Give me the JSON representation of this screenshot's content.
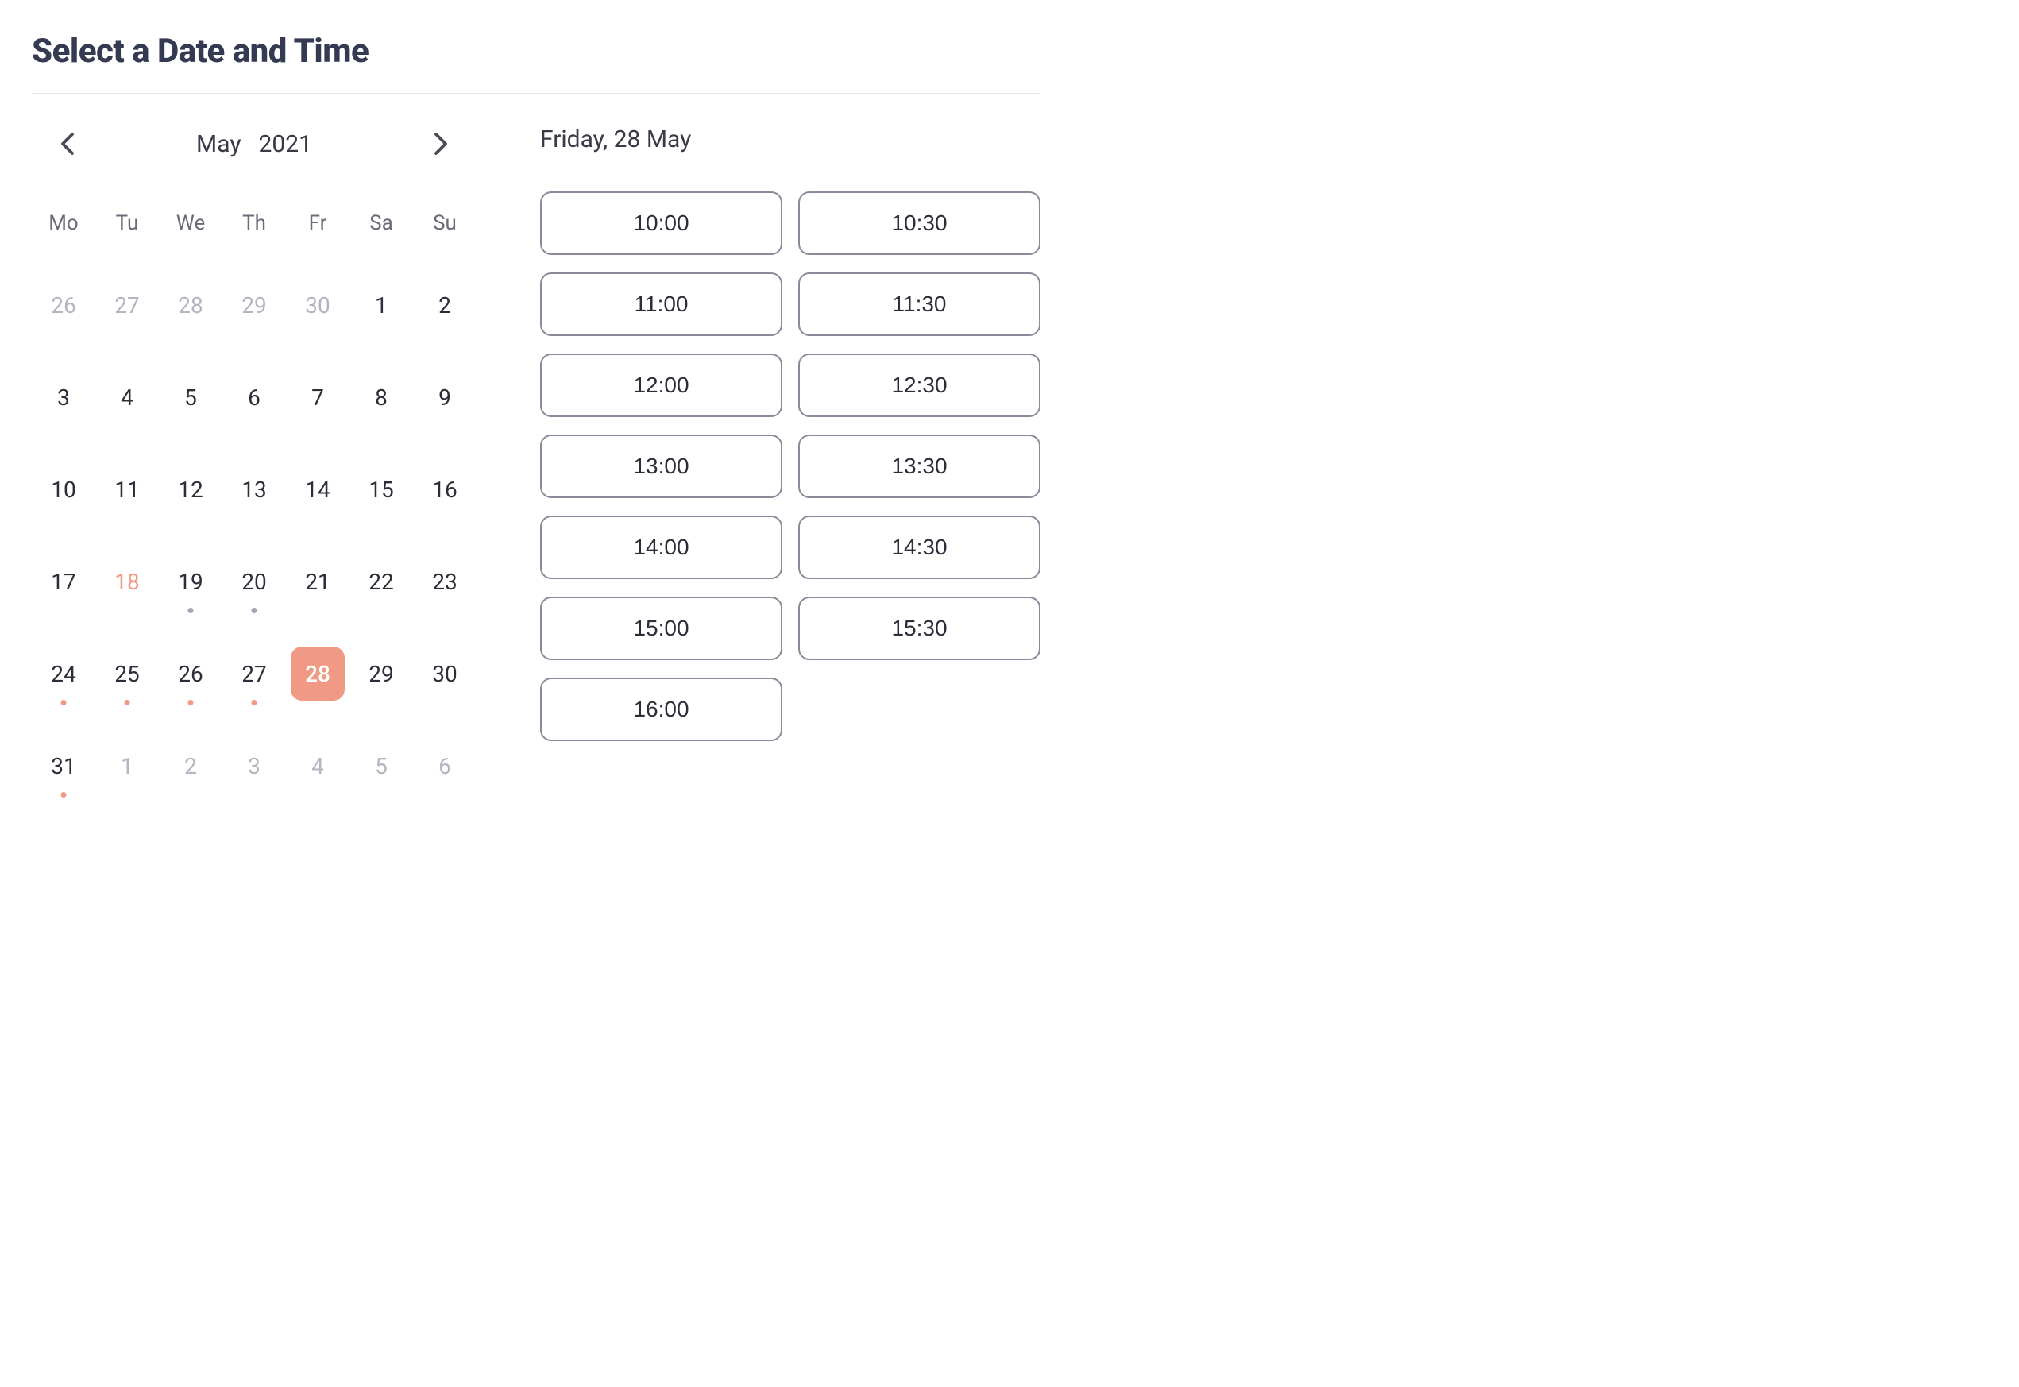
{
  "title": "Select a Date and Time",
  "calendar": {
    "month": "May",
    "year": "2021",
    "dayHeaders": [
      "Mo",
      "Tu",
      "We",
      "Th",
      "Fr",
      "Sa",
      "Su"
    ],
    "days": [
      {
        "num": "26",
        "otherMonth": true
      },
      {
        "num": "27",
        "otherMonth": true
      },
      {
        "num": "28",
        "otherMonth": true
      },
      {
        "num": "29",
        "otherMonth": true
      },
      {
        "num": "30",
        "otherMonth": true
      },
      {
        "num": "1"
      },
      {
        "num": "2"
      },
      {
        "num": "3"
      },
      {
        "num": "4"
      },
      {
        "num": "5"
      },
      {
        "num": "6"
      },
      {
        "num": "7"
      },
      {
        "num": "8"
      },
      {
        "num": "9"
      },
      {
        "num": "10"
      },
      {
        "num": "11"
      },
      {
        "num": "12"
      },
      {
        "num": "13"
      },
      {
        "num": "14"
      },
      {
        "num": "15"
      },
      {
        "num": "16"
      },
      {
        "num": "17"
      },
      {
        "num": "18",
        "highlighted": true
      },
      {
        "num": "19",
        "dot": "gray"
      },
      {
        "num": "20",
        "dot": "gray"
      },
      {
        "num": "21"
      },
      {
        "num": "22"
      },
      {
        "num": "23"
      },
      {
        "num": "24",
        "dot": "accent"
      },
      {
        "num": "25",
        "dot": "accent"
      },
      {
        "num": "26",
        "dot": "accent"
      },
      {
        "num": "27",
        "dot": "accent"
      },
      {
        "num": "28",
        "selected": true
      },
      {
        "num": "29"
      },
      {
        "num": "30"
      },
      {
        "num": "31",
        "dot": "accent"
      },
      {
        "num": "1",
        "otherMonth": true
      },
      {
        "num": "2",
        "otherMonth": true
      },
      {
        "num": "3",
        "otherMonth": true
      },
      {
        "num": "4",
        "otherMonth": true
      },
      {
        "num": "5",
        "otherMonth": true
      },
      {
        "num": "6",
        "otherMonth": true
      }
    ]
  },
  "selectedDateLabel": "Friday, 28 May",
  "timeSlots": [
    "10:00",
    "10:30",
    "11:00",
    "11:30",
    "12:00",
    "12:30",
    "13:00",
    "13:30",
    "14:00",
    "14:30",
    "15:00",
    "15:30",
    "16:00"
  ]
}
